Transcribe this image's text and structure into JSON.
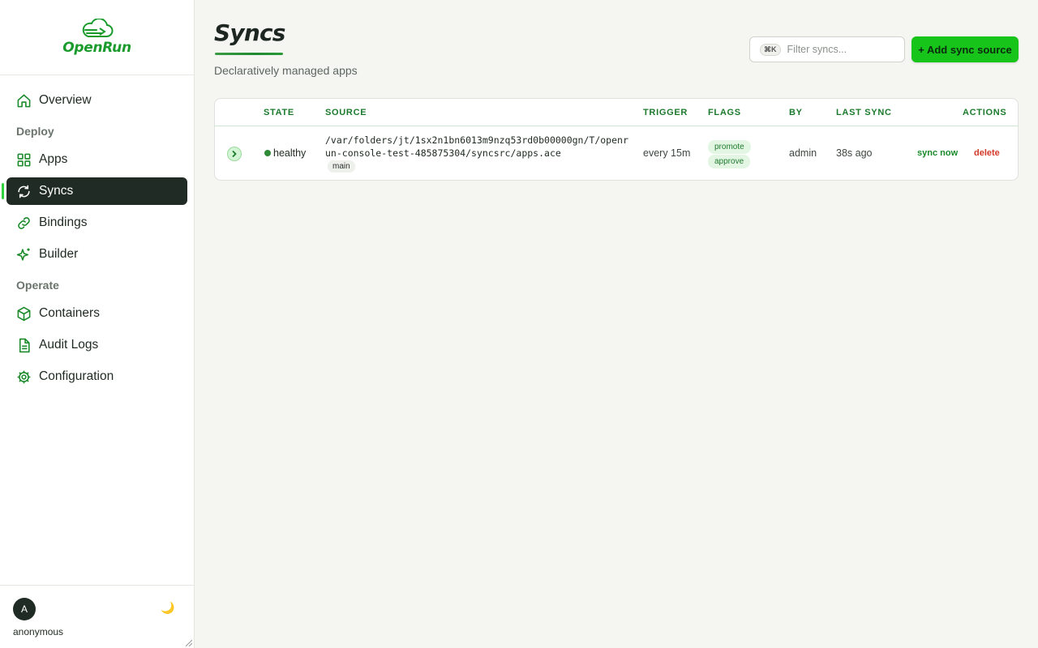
{
  "brand": {
    "name": "OpenRun",
    "icon": "cloud-logo-icon"
  },
  "sidebar": {
    "items": [
      {
        "label": "Overview",
        "icon": "home-icon"
      },
      {
        "section": "Deploy"
      },
      {
        "label": "Apps",
        "icon": "grid-icon"
      },
      {
        "label": "Syncs",
        "icon": "refresh-icon",
        "active": true
      },
      {
        "label": "Bindings",
        "icon": "link-icon"
      },
      {
        "label": "Builder",
        "icon": "sparkle-icon"
      },
      {
        "section": "Operate"
      },
      {
        "label": "Containers",
        "icon": "box-icon"
      },
      {
        "label": "Audit Logs",
        "icon": "document-icon"
      },
      {
        "label": "Configuration",
        "icon": "gear-icon"
      }
    ],
    "user": {
      "initial": "A",
      "name": "anonymous"
    },
    "theme_icon": "🌙"
  },
  "header": {
    "title": "Syncs",
    "subtitle": "Declaratively managed apps",
    "filter": {
      "shortcut": "⌘K",
      "placeholder": "Filter syncs..."
    },
    "add_label": "+ Add sync source"
  },
  "table": {
    "columns": [
      "STATE",
      "SOURCE",
      "TRIGGER",
      "FLAGS",
      "BY",
      "LAST SYNC",
      "ACTIONS"
    ],
    "rows": [
      {
        "state": "healthy",
        "source": "/var/folders/jt/1sx2n1bn6013m9nzq53rd0b00000gn/T/openrun-console-test-485875304/syncsrc/apps.ace",
        "branch": "main",
        "trigger": "every 15m",
        "flags": [
          "promote",
          "approve"
        ],
        "by": "admin",
        "last_sync": "38s ago",
        "actions": {
          "sync": "sync now",
          "delete": "delete"
        }
      }
    ]
  },
  "colors": {
    "accent": "#17c419",
    "brand": "#1a9b2c",
    "active_nav": "#1f2b24",
    "danger": "#d33a2c"
  }
}
